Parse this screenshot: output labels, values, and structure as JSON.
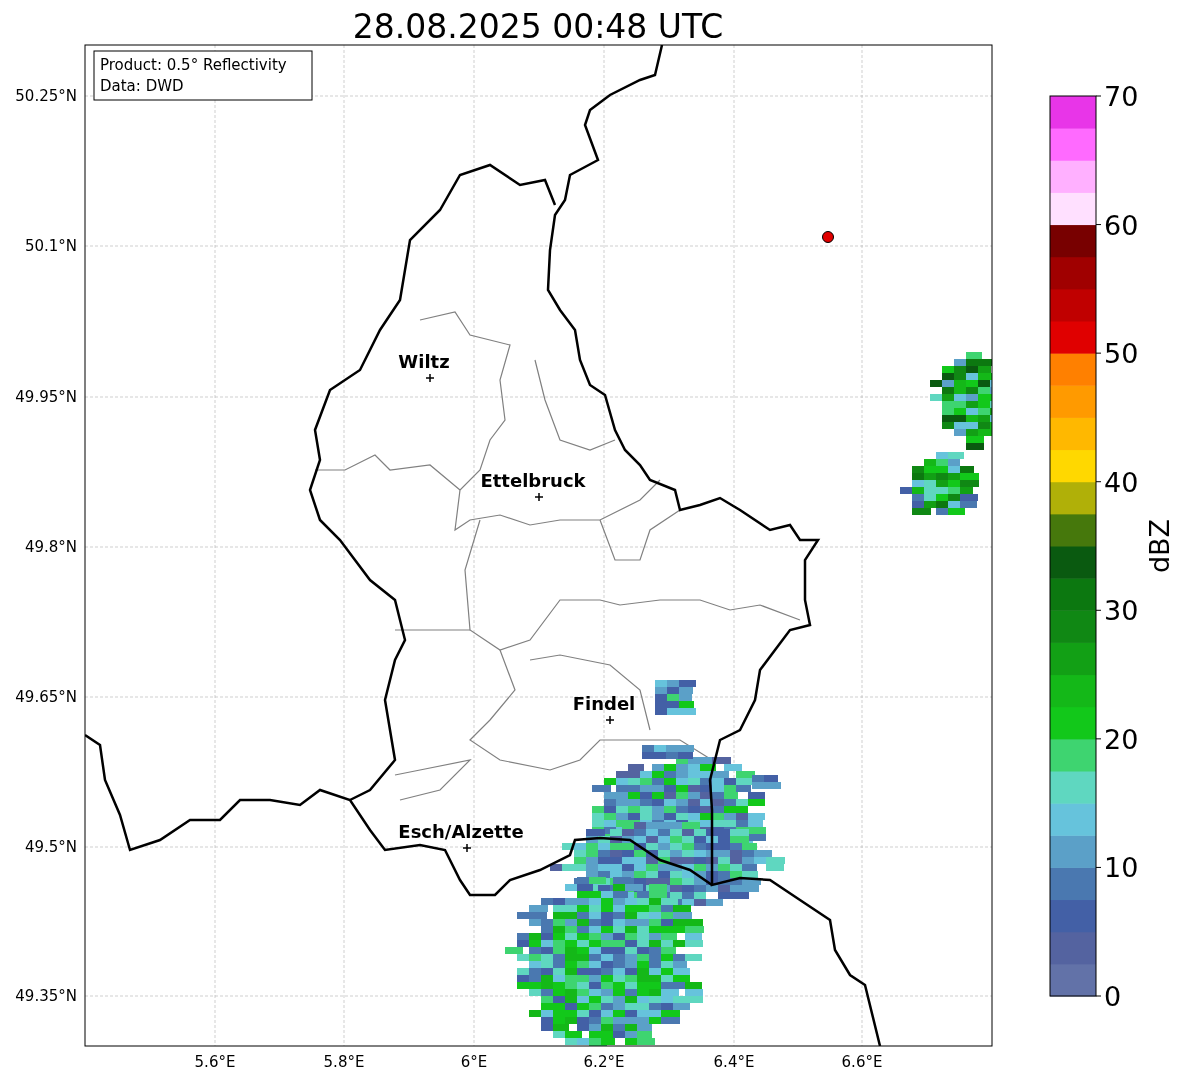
{
  "title": "28.08.2025 00:48 UTC",
  "info_box": [
    "Product: 0.5° Reflectivity",
    "Data: DWD"
  ],
  "y_ticks": [
    "50.25°N",
    "50.1°N",
    "49.95°N",
    "49.8°N",
    "49.65°N",
    "49.5°N",
    "49.35°N"
  ],
  "x_ticks": [
    "5.6°E",
    "5.8°E",
    "6°E",
    "6.2°E",
    "6.4°E",
    "6.6°E"
  ],
  "cities": [
    {
      "name": "Wiltz"
    },
    {
      "name": "Ettelbruck"
    },
    {
      "name": "Findel"
    },
    {
      "name": "Esch/Alzette"
    }
  ],
  "colorbar": {
    "label": "dBZ",
    "ticks": [
      "70",
      "60",
      "50",
      "40",
      "30",
      "20",
      "10",
      "0"
    ],
    "segments": [
      {
        "color": "#6272a8"
      },
      {
        "color": "#5463a0"
      },
      {
        "color": "#4360a6"
      },
      {
        "color": "#4a78b0"
      },
      {
        "color": "#5ba0c8"
      },
      {
        "color": "#66c3dc"
      },
      {
        "color": "#5fd7c0"
      },
      {
        "color": "#3ed470"
      },
      {
        "color": "#12c81a"
      },
      {
        "color": "#14b818"
      },
      {
        "color": "#12a015"
      },
      {
        "color": "#108814"
      },
      {
        "color": "#0c7810"
      },
      {
        "color": "#0a5a10"
      },
      {
        "color": "#46780c"
      },
      {
        "color": "#b0b008"
      },
      {
        "color": "#ffd800"
      },
      {
        "color": "#ffb800"
      },
      {
        "color": "#ff9a00"
      },
      {
        "color": "#ff8000"
      },
      {
        "color": "#e00000"
      },
      {
        "color": "#c00000"
      },
      {
        "color": "#a00000"
      },
      {
        "color": "#780000"
      },
      {
        "color": "#ffe0ff"
      },
      {
        "color": "#ffb0ff"
      },
      {
        "color": "#ff6aff"
      },
      {
        "color": "#e835e8"
      }
    ]
  }
}
